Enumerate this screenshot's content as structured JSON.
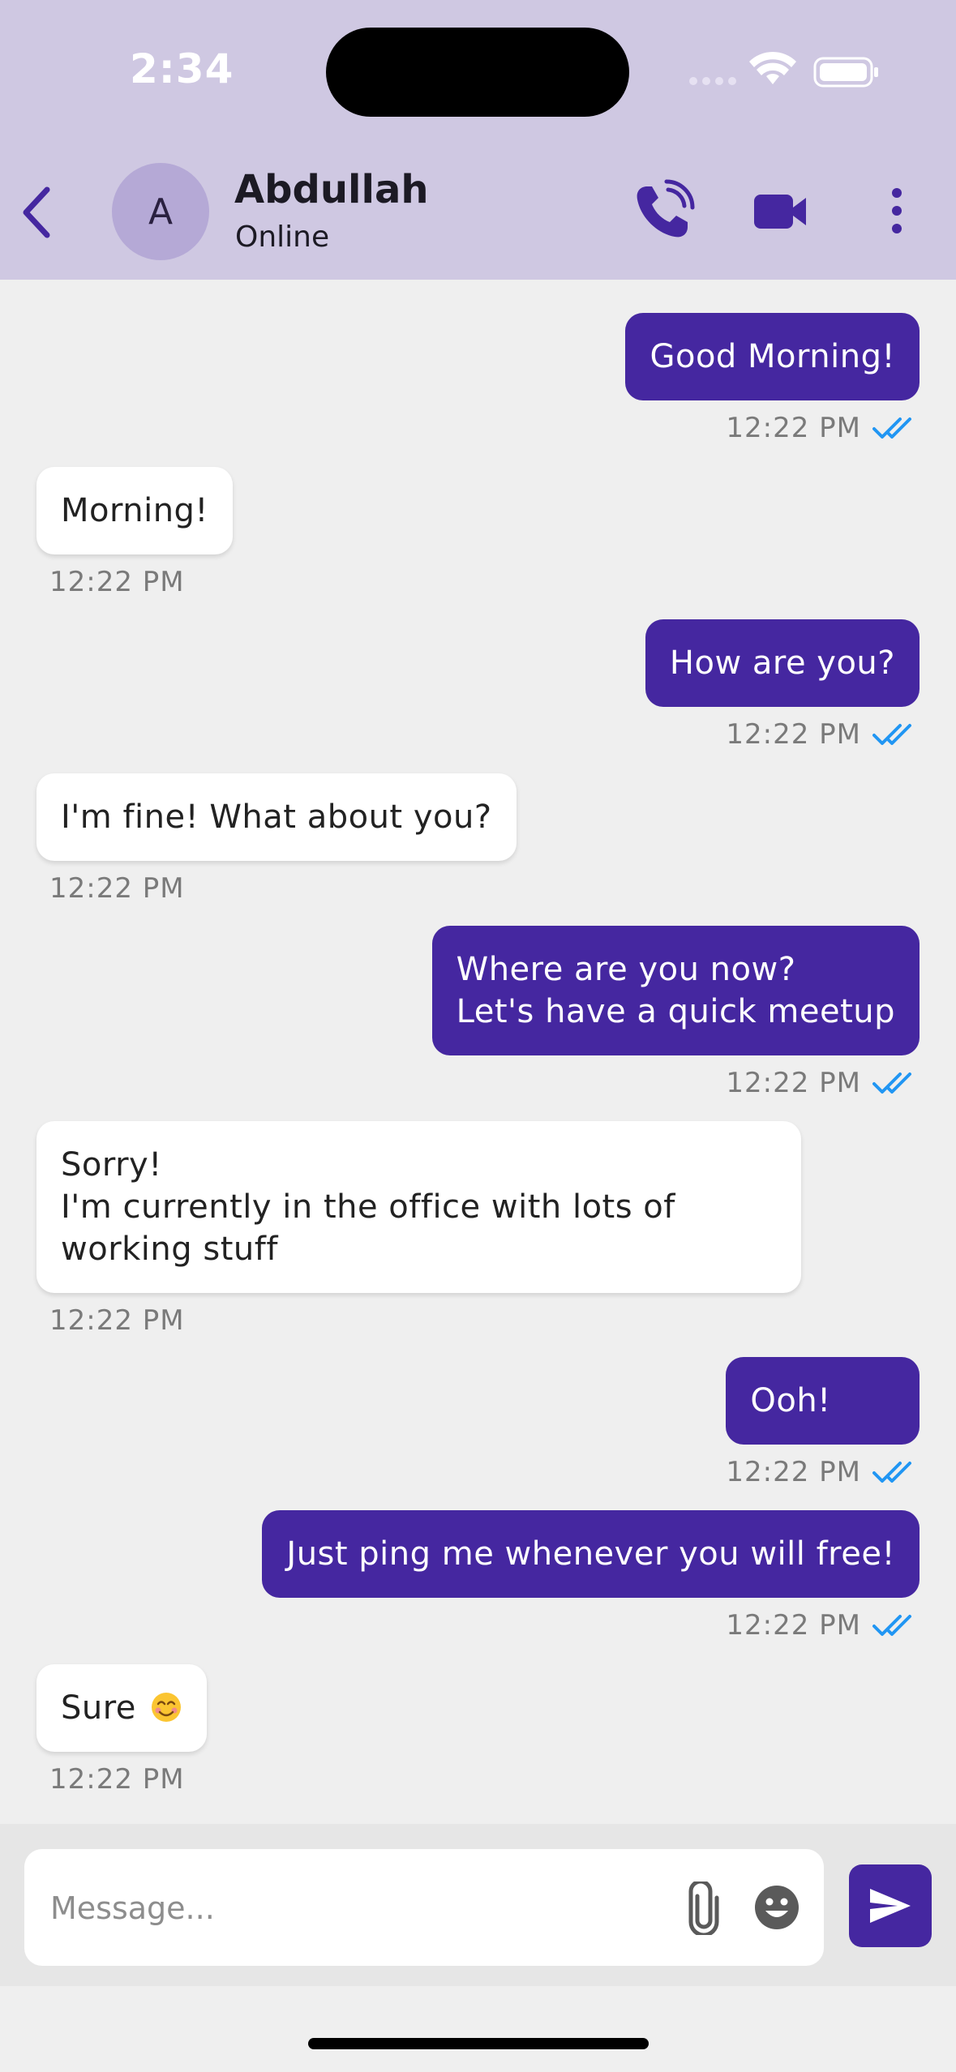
{
  "status_bar": {
    "time": "2:34"
  },
  "header": {
    "avatar_letter": "A",
    "contact_name": "Abdullah",
    "contact_status": "Online",
    "icons": [
      "back-icon",
      "phone-call-icon",
      "video-camera-icon",
      "more-vertical-icon"
    ]
  },
  "messages": [
    {
      "sender": "me",
      "text": "Good Morning!",
      "time": "12:22 PM",
      "read": true
    },
    {
      "sender": "them",
      "text": "Morning!",
      "time": "12:22 PM"
    },
    {
      "sender": "me",
      "text": "How are you?",
      "time": "12:22 PM",
      "read": true
    },
    {
      "sender": "them",
      "text": "I'm fine! What about you?",
      "time": "12:22 PM"
    },
    {
      "sender": "me",
      "text": "Where are you now?\nLet's have a quick meetup",
      "time": "12:22 PM",
      "read": true
    },
    {
      "sender": "them",
      "text": "Sorry!\nI'm currently in the office with lots of\nworking stuff",
      "time": "12:22 PM"
    },
    {
      "sender": "me",
      "text": "Ooh!",
      "time": "12:22 PM",
      "read": true
    },
    {
      "sender": "me",
      "text": "Just ping me whenever you will free!",
      "time": "12:22 PM",
      "read": true
    },
    {
      "sender": "them",
      "text": "Sure",
      "emoji": "smiling-face-emoji",
      "time": "12:22 PM"
    }
  ],
  "composer": {
    "placeholder": "Message...",
    "value": "",
    "icons": [
      "attachment-icon",
      "emoji-icon",
      "send-icon"
    ]
  },
  "colors": {
    "header_bg": "#cfc8e2",
    "accent": "#4527a0",
    "read_check": "#2196f3",
    "chat_bg": "#efefef"
  }
}
